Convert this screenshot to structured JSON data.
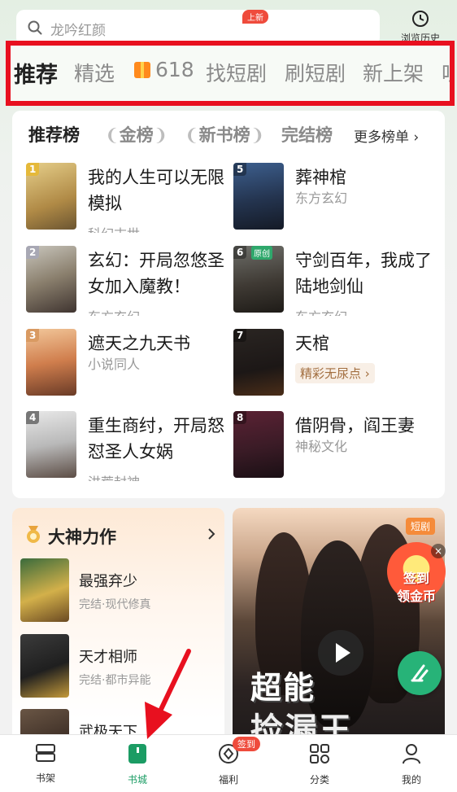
{
  "search": {
    "placeholder": "龙吟红颜",
    "history_label": "浏览历史"
  },
  "top_tabs": [
    {
      "label": "推荐",
      "active": true
    },
    {
      "label": "精选"
    },
    {
      "label": "618",
      "icon": "gift-icon"
    },
    {
      "label": "找短剧",
      "badge": "上新"
    },
    {
      "label": "刷短剧"
    },
    {
      "label": "新上架"
    },
    {
      "label": "听"
    }
  ],
  "rank": {
    "tabs": [
      {
        "label": "推荐榜",
        "active": true
      },
      {
        "label": "金榜"
      },
      {
        "label": "新书榜"
      },
      {
        "label": "完结榜"
      }
    ],
    "more_label": "更多榜单",
    "books": [
      {
        "rank": "1",
        "title": "我的人生可以无限模拟",
        "sub": "科幻末世"
      },
      {
        "rank": "5",
        "title": "葬神棺",
        "sub": "东方玄幻"
      },
      {
        "rank": "2",
        "title": "玄幻：开局忽悠圣女加入魔教！",
        "sub": "东方玄幻"
      },
      {
        "rank": "6",
        "title": "守剑百年，我成了陆地剑仙",
        "sub": "东方玄幻",
        "badge": "原创"
      },
      {
        "rank": "3",
        "title": "遮天之九天书",
        "sub": "小说同人"
      },
      {
        "rank": "7",
        "title": "天棺",
        "pill": "精彩无尿点 ›"
      },
      {
        "rank": "4",
        "title": "重生商纣，开局怒怼圣人女娲",
        "sub": "洪荒封神"
      },
      {
        "rank": "8",
        "title": "借阴骨，阎王妻",
        "sub": "神秘文化"
      }
    ]
  },
  "god_section": {
    "title": "大神力作",
    "books": [
      {
        "title": "最强弃少",
        "sub": "完结·现代修真"
      },
      {
        "title": "天才相师",
        "sub": "完结·都市异能"
      },
      {
        "title": "武极天下",
        "sub": ""
      }
    ]
  },
  "drama": {
    "tag": "短剧",
    "title_line1": "超能",
    "title_line2": "捡漏王"
  },
  "float_signin": {
    "line1": "签到",
    "line2": "领金币"
  },
  "bottom_nav": [
    {
      "label": "书架",
      "icon": "bookshelf-icon"
    },
    {
      "label": "书城",
      "icon": "bookstore-icon",
      "active": true
    },
    {
      "label": "福利",
      "icon": "coin-icon",
      "badge": "签到"
    },
    {
      "label": "分类",
      "icon": "category-icon"
    },
    {
      "label": "我的",
      "icon": "profile-icon"
    }
  ],
  "colors": {
    "accent": "#27b378",
    "highlight": "#e8101f",
    "badge": "#ef4b3c"
  }
}
